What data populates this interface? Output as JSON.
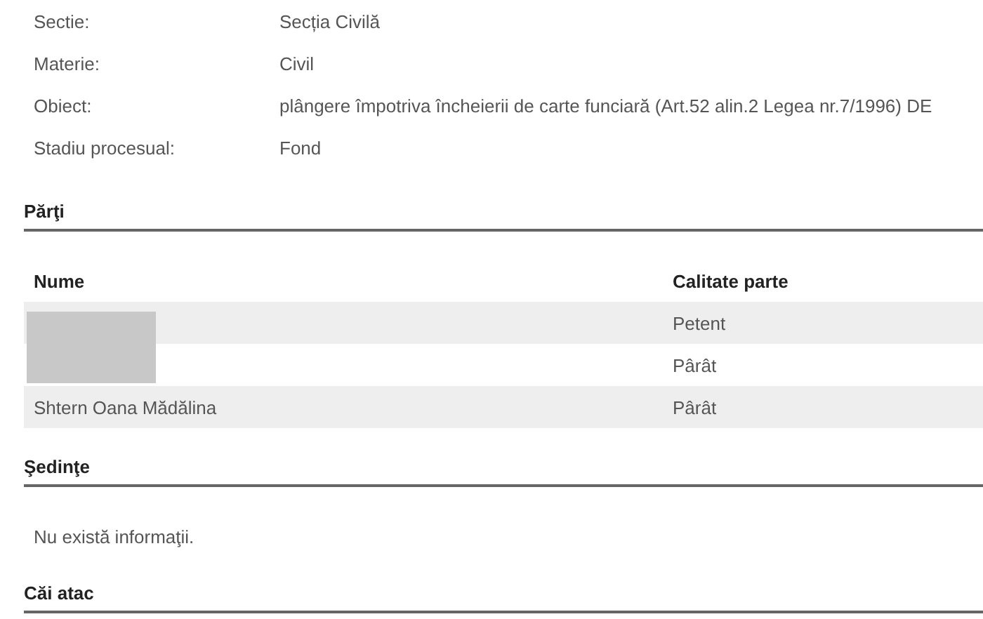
{
  "details": [
    {
      "label": "Sectie:",
      "value": "Secția Civilă"
    },
    {
      "label": "Materie:",
      "value": "Civil"
    },
    {
      "label": "Obiect:",
      "value": "plângere împotriva încheierii de carte funciară (Art.52 alin.2 Legea nr.7/1996) DE"
    },
    {
      "label": "Stadiu procesual:",
      "value": "Fond"
    }
  ],
  "parti": {
    "title": "Părţi",
    "columns": [
      "Nume",
      "Calitate parte"
    ],
    "rows": [
      {
        "name_redacted": true,
        "role": "Petent"
      },
      {
        "name_redacted": true,
        "role": "Pârât"
      },
      {
        "name_redacted": false,
        "name": "Shtern Oana Mădălina",
        "role": "Pârât"
      }
    ]
  },
  "sedinte": {
    "title": "Şedinţe",
    "message": "Nu există informaţii."
  },
  "cai_atac": {
    "title": "Căi atac"
  }
}
